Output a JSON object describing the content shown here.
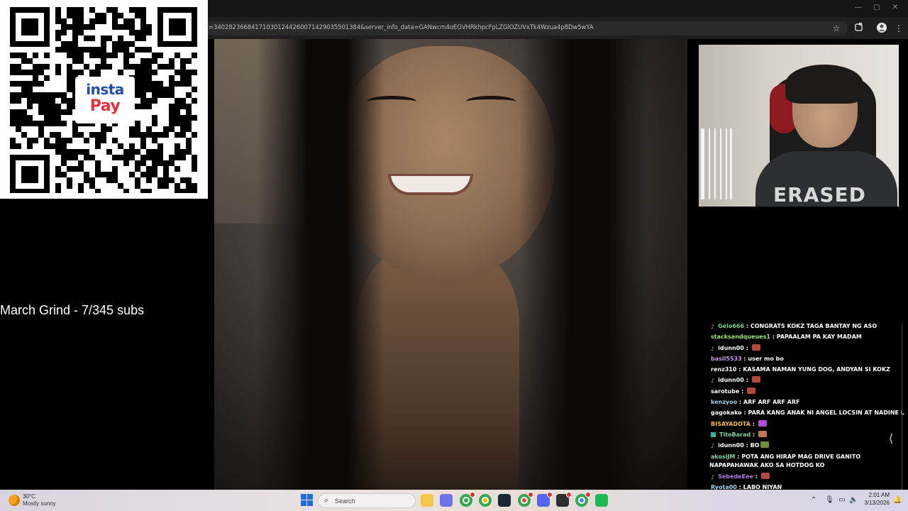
{
  "browser": {
    "url": "=340282366841710301244260071429035501384&server_info_data=GANwcm4oEGVHRkhpcFpLZGlOZUVxTk4Wzua4p8Dw5wYA",
    "window_controls": [
      "—",
      "▢",
      "✕"
    ],
    "toolbar_icons": [
      "star-icon",
      "extensions-icon",
      "profile-icon",
      "menu-icon"
    ]
  },
  "overlay": {
    "qr_logo_top": "insta",
    "qr_logo_bottom": "Pay",
    "grind_text": "March Grind - 7/345 subs"
  },
  "webcam": {
    "shirt_text": "ERASED"
  },
  "chat": {
    "messages": [
      {
        "user": "Gelo666",
        "color": "#7fd37f",
        "badge": "note",
        "text": "CONGRATS KOKZ TAGA BANTAY NG ASO",
        "emote": ""
      },
      {
        "user": "stacksandqueues1",
        "color": "#9be76f",
        "badge": "",
        "text": "PAPAALAM PA KAY MADAM",
        "emote": ""
      },
      {
        "user": "idunn00",
        "color": "#ffffff",
        "badge": "note",
        "text": "",
        "emote": "#b0483e"
      },
      {
        "user": "basil5533",
        "color": "#c89ae6",
        "badge": "",
        "text": "user mo bo",
        "emote": ""
      },
      {
        "user": "renz310",
        "color": "#ffffff",
        "badge": "",
        "text": "KASAMA NAMAN YUNG DOG, ANDYAN SI KOKZ",
        "emote": ""
      },
      {
        "user": "idunn00",
        "color": "#ffffff",
        "badge": "note",
        "text": "",
        "emote": "#b0483e"
      },
      {
        "user": "sarotube",
        "color": "#ffffff",
        "badge": "",
        "text": "",
        "emote": "#b0483e"
      },
      {
        "user": "kenzyoo",
        "color": "#9ad2f2",
        "badge": "",
        "text": "ARF ARF ARF ARF",
        "emote": ""
      },
      {
        "user": "gagokako",
        "color": "#ffffff",
        "badge": "",
        "text": "PARA KANG ANAK NI ANGEL LOCSIN AT NADINE LUSTRE TE",
        "emote": ""
      },
      {
        "user": "BISAYADOTA",
        "color": "#f2b84b",
        "badge": "",
        "text": "",
        "emote": "#b04fd6"
      },
      {
        "user": "TitoBarad",
        "color": "#7fd3a0",
        "badge": "sub",
        "text": "",
        "emote": "#c27a52"
      },
      {
        "user": "idunn00",
        "color": "#ffffff",
        "badge": "note",
        "text": "BO",
        "emote": "#6e8f3a"
      },
      {
        "user": "akosiJM",
        "color": "#7fd3a0",
        "badge": "",
        "text": "POTA ANG HIRAP MAG DRIVE GANITO NAPAPAHAWAK AKO SA HOTDOG KO",
        "emote": "",
        "wrap": true
      },
      {
        "user": "SebedeEee",
        "color": "#b57ae6",
        "badge": "note",
        "text": "",
        "emote": "#b0483e"
      },
      {
        "user": "Ryota00",
        "color": "#9ad2f2",
        "badge": "",
        "text": "LABO NIYAN",
        "emote": ""
      }
    ]
  },
  "taskbar": {
    "weather_temp": "30°C",
    "weather_condition": "Mostly sunny",
    "search_label": "Search",
    "clock_time": "2:01 AM",
    "clock_date": "3/13/2026",
    "apps": [
      {
        "name": "file-explorer",
        "color": "#f4c64a",
        "badge": false
      },
      {
        "name": "copilot",
        "color": "#6f73e8",
        "badge": false
      },
      {
        "name": "chrome-profile-1",
        "color": "#34a853",
        "badge": true
      },
      {
        "name": "chrome",
        "color": "#fbbc05",
        "badge": false
      },
      {
        "name": "steam",
        "color": "#1b2838",
        "badge": false
      },
      {
        "name": "chrome-profile-2",
        "color": "#ea4335",
        "badge": true
      },
      {
        "name": "discord",
        "color": "#5865f2",
        "badge": true
      },
      {
        "name": "obs-studio",
        "color": "#302e31",
        "badge": true
      },
      {
        "name": "chrome-profile-3",
        "color": "#4285f4",
        "badge": true
      },
      {
        "name": "spotify-terminal",
        "color": "#1db954",
        "badge": false
      }
    ]
  }
}
